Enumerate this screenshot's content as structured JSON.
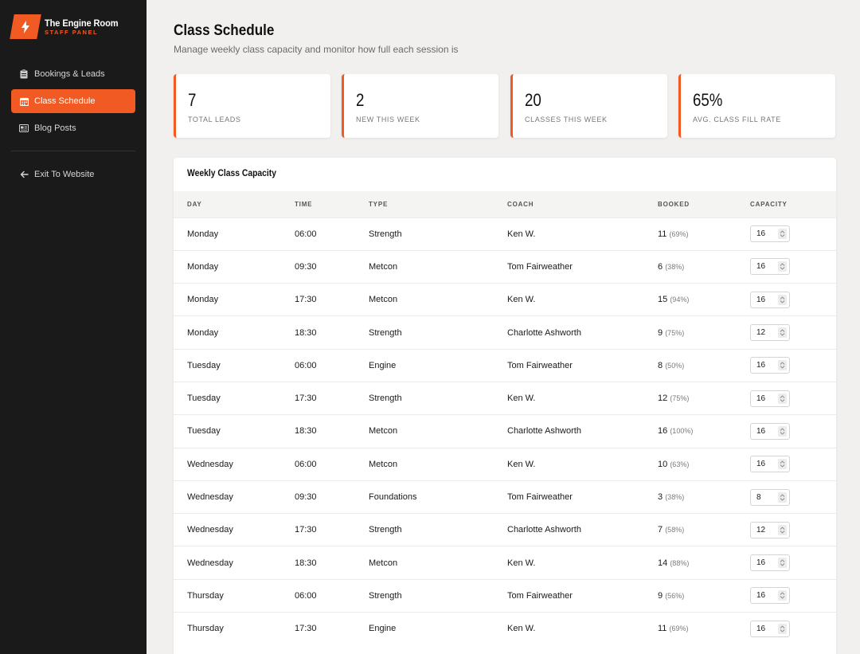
{
  "brand": {
    "title": "The Engine Room",
    "subtitle": "STAFF PANEL"
  },
  "sidebar": {
    "items": [
      {
        "label": "Bookings & Leads",
        "icon": "clipboard-icon",
        "active": false
      },
      {
        "label": "Class Schedule",
        "icon": "calendar-icon",
        "active": true
      },
      {
        "label": "Blog Posts",
        "icon": "newspaper-icon",
        "active": false
      }
    ],
    "exit_label": "Exit To Website"
  },
  "page": {
    "title": "Class Schedule",
    "subtitle": "Manage weekly class capacity and monitor how full each session is"
  },
  "stats": [
    {
      "value": "7",
      "label": "TOTAL LEADS"
    },
    {
      "value": "2",
      "label": "NEW THIS WEEK"
    },
    {
      "value": "20",
      "label": "CLASSES THIS WEEK"
    },
    {
      "value": "65%",
      "label": "AVG. CLASS FILL RATE"
    }
  ],
  "panel": {
    "title": "Weekly Class Capacity",
    "columns": [
      "DAY",
      "TIME",
      "TYPE",
      "COACH",
      "BOOKED",
      "CAPACITY"
    ],
    "rows": [
      {
        "day": "Monday",
        "time": "06:00",
        "type": "Strength",
        "coach": "Ken W.",
        "booked": "11",
        "pct": "(69%)",
        "capacity": "16"
      },
      {
        "day": "Monday",
        "time": "09:30",
        "type": "Metcon",
        "coach": "Tom Fairweather",
        "booked": "6",
        "pct": "(38%)",
        "capacity": "16"
      },
      {
        "day": "Monday",
        "time": "17:30",
        "type": "Metcon",
        "coach": "Ken W.",
        "booked": "15",
        "pct": "(94%)",
        "capacity": "16"
      },
      {
        "day": "Monday",
        "time": "18:30",
        "type": "Strength",
        "coach": "Charlotte Ashworth",
        "booked": "9",
        "pct": "(75%)",
        "capacity": "12"
      },
      {
        "day": "Tuesday",
        "time": "06:00",
        "type": "Engine",
        "coach": "Tom Fairweather",
        "booked": "8",
        "pct": "(50%)",
        "capacity": "16"
      },
      {
        "day": "Tuesday",
        "time": "17:30",
        "type": "Strength",
        "coach": "Ken W.",
        "booked": "12",
        "pct": "(75%)",
        "capacity": "16"
      },
      {
        "day": "Tuesday",
        "time": "18:30",
        "type": "Metcon",
        "coach": "Charlotte Ashworth",
        "booked": "16",
        "pct": "(100%)",
        "capacity": "16"
      },
      {
        "day": "Wednesday",
        "time": "06:00",
        "type": "Metcon",
        "coach": "Ken W.",
        "booked": "10",
        "pct": "(63%)",
        "capacity": "16"
      },
      {
        "day": "Wednesday",
        "time": "09:30",
        "type": "Foundations",
        "coach": "Tom Fairweather",
        "booked": "3",
        "pct": "(38%)",
        "capacity": "8"
      },
      {
        "day": "Wednesday",
        "time": "17:30",
        "type": "Strength",
        "coach": "Charlotte Ashworth",
        "booked": "7",
        "pct": "(58%)",
        "capacity": "12"
      },
      {
        "day": "Wednesday",
        "time": "18:30",
        "type": "Metcon",
        "coach": "Ken W.",
        "booked": "14",
        "pct": "(88%)",
        "capacity": "16"
      },
      {
        "day": "Thursday",
        "time": "06:00",
        "type": "Strength",
        "coach": "Tom Fairweather",
        "booked": "9",
        "pct": "(56%)",
        "capacity": "16"
      },
      {
        "day": "Thursday",
        "time": "17:30",
        "type": "Engine",
        "coach": "Ken W.",
        "booked": "11",
        "pct": "(69%)",
        "capacity": "16"
      }
    ]
  },
  "colors": {
    "accent": "#f15a22",
    "sidebar_bg": "#1a1a1a",
    "page_bg": "#f1f0ee"
  }
}
